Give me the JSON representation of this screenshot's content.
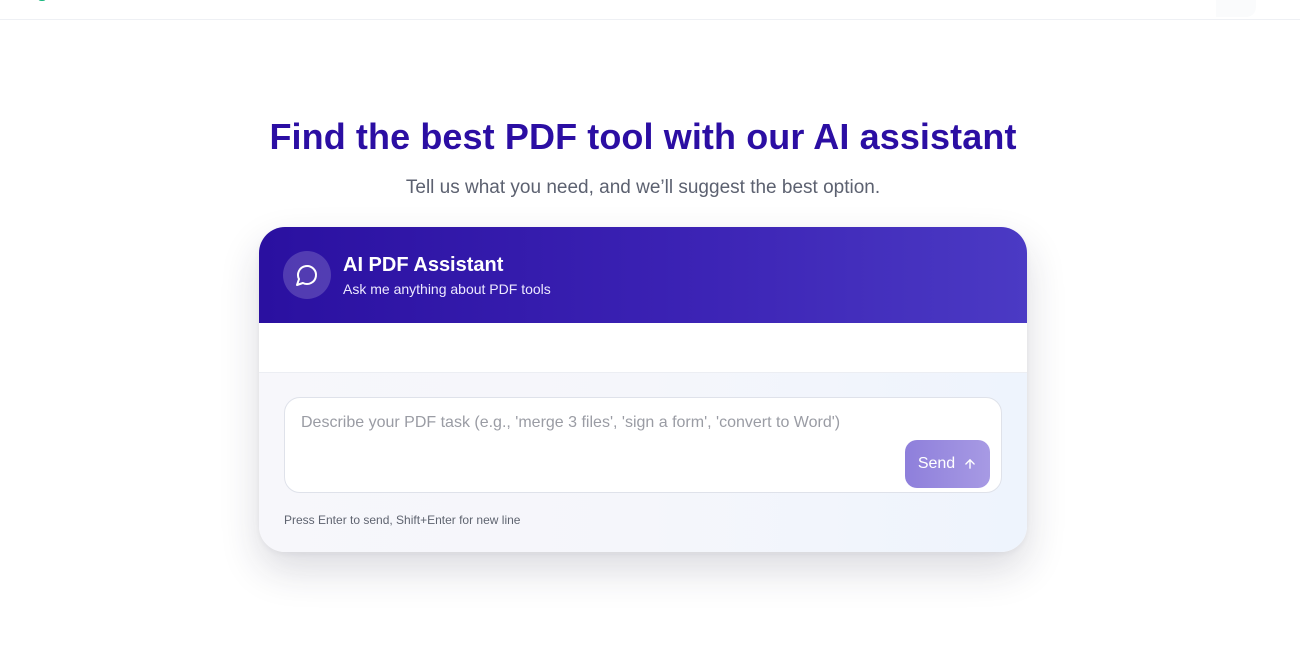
{
  "hero": {
    "title": "Find the best PDF tool with our AI assistant",
    "subtitle": "Tell us what you need, and we’ll suggest the best option."
  },
  "assistant": {
    "title": "AI PDF Assistant",
    "subtitle": "Ask me anything about PDF tools",
    "avatar_icon": "chat-bubble-icon"
  },
  "composer": {
    "placeholder": "Describe your PDF task (e.g., 'merge 3 files', 'sign a form', 'convert to Word')",
    "value": "",
    "send_label": "Send",
    "send_icon": "arrow-up-icon",
    "hint": "Press Enter to send, Shift+Enter for new line"
  },
  "colors": {
    "title": "#2b0ea3",
    "header_gradient_start": "#2a10a0",
    "header_gradient_end": "#4b3ac4",
    "send_button": "#9a8ce0"
  }
}
